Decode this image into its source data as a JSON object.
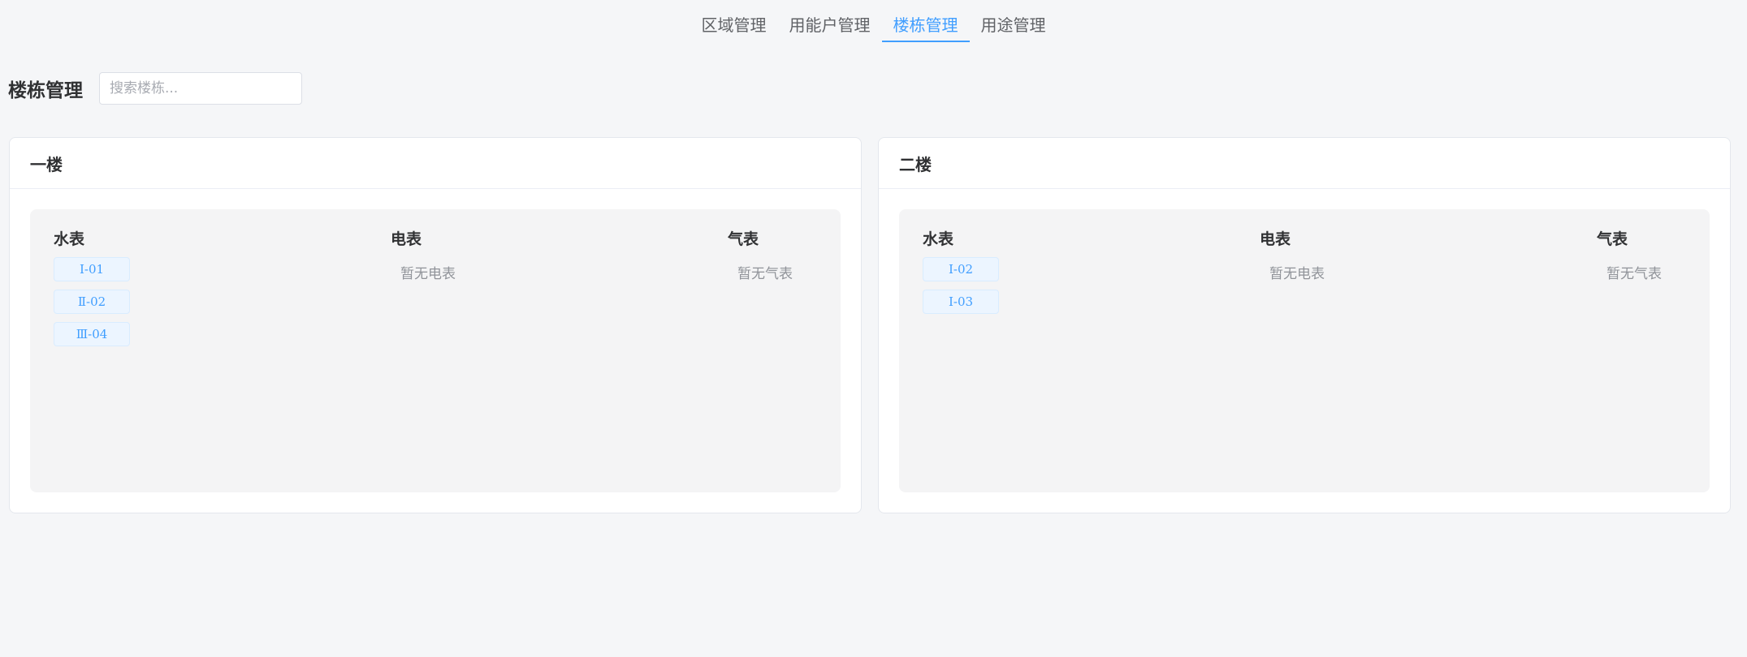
{
  "tabs": [
    {
      "label": "区域管理",
      "active": false
    },
    {
      "label": "用能户管理",
      "active": false
    },
    {
      "label": "楼栋管理",
      "active": true
    },
    {
      "label": "用途管理",
      "active": false
    }
  ],
  "page": {
    "title": "楼栋管理",
    "search_placeholder": "搜索楼栋..."
  },
  "buildings": [
    {
      "name": "一楼",
      "water": {
        "title": "水表",
        "meters": [
          "Ⅰ-01",
          "Ⅱ-02",
          "Ⅲ-04"
        ]
      },
      "electric": {
        "title": "电表",
        "empty": "暂无电表"
      },
      "gas": {
        "title": "气表",
        "empty": "暂无气表"
      }
    },
    {
      "name": "二楼",
      "water": {
        "title": "水表",
        "meters": [
          "Ⅰ-02",
          "Ⅰ-03"
        ]
      },
      "electric": {
        "title": "电表",
        "empty": "暂无电表"
      },
      "gas": {
        "title": "气表",
        "empty": "暂无气表"
      }
    }
  ],
  "colors": {
    "accent": "#409eff",
    "background": "#f5f6f8"
  }
}
